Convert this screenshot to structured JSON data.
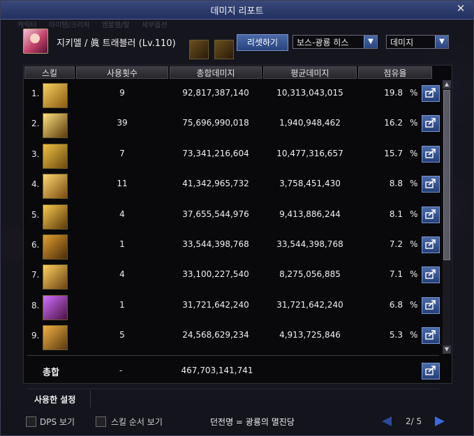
{
  "window": {
    "title": "데미지 리포트",
    "close_label": "✕"
  },
  "background_tabs": [
    "캐릭터",
    "아이템/크리처",
    "엠블렘/탈",
    "세부옵션"
  ],
  "character": {
    "name": "지키멜 / 眞 트래블러 (Lv.110)"
  },
  "controls": {
    "reset_label": "리셋하기",
    "filter_value": "보스-광룡 히스",
    "mode_value": "데미지"
  },
  "columns": [
    "스킬",
    "사용횟수",
    "총합데미지",
    "평균데미지",
    "점유율"
  ],
  "rows": [
    {
      "rank": "1.",
      "count": "9",
      "total": "92,817,387,140",
      "avg": "10,313,043,015",
      "share": "19.8"
    },
    {
      "rank": "2.",
      "count": "39",
      "total": "75,696,990,018",
      "avg": "1,940,948,462",
      "share": "16.2"
    },
    {
      "rank": "3.",
      "count": "7",
      "total": "73,341,216,604",
      "avg": "10,477,316,657",
      "share": "15.7"
    },
    {
      "rank": "4.",
      "count": "11",
      "total": "41,342,965,732",
      "avg": "3,758,451,430",
      "share": "8.8"
    },
    {
      "rank": "5.",
      "count": "4",
      "total": "37,655,544,976",
      "avg": "9,413,886,244",
      "share": "8.1"
    },
    {
      "rank": "6.",
      "count": "1",
      "total": "33,544,398,768",
      "avg": "33,544,398,768",
      "share": "7.2"
    },
    {
      "rank": "7.",
      "count": "4",
      "total": "33,100,227,540",
      "avg": "8,275,056,885",
      "share": "7.1"
    },
    {
      "rank": "8.",
      "count": "1",
      "total": "31,721,642,240",
      "avg": "31,721,642,240",
      "share": "6.8"
    },
    {
      "rank": "9.",
      "count": "5",
      "total": "24,568,629,234",
      "avg": "4,913,725,846",
      "share": "5.3"
    }
  ],
  "percent_sign": "%",
  "totals": {
    "label": "총합",
    "count": "-",
    "total": "467,703,141,741"
  },
  "settings": {
    "label": "사용한 설정"
  },
  "footer": {
    "dps_label": "DPS 보기",
    "skill_order_label": "스킬 순서 보기",
    "dungeon_text": "던전명 = 광룡의 멸진당",
    "page": "2/ 5"
  },
  "colors": {
    "accent_blue": "#2a4480",
    "title_bar": "#223060"
  }
}
